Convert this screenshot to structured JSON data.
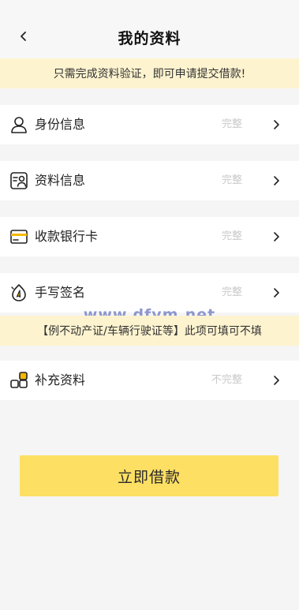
{
  "header": {
    "title": "我的资料",
    "back_icon": "chevron-left-icon"
  },
  "notice_top": "只需完成资料验证，即可申请提交借款!",
  "items": [
    {
      "label": "身份信息",
      "status": "完整",
      "icon": "person-icon"
    },
    {
      "label": "资料信息",
      "status": "完整",
      "icon": "id-card-icon"
    },
    {
      "label": "收款银行卡",
      "status": "完整",
      "icon": "bank-card-icon"
    },
    {
      "label": "手写签名",
      "status": "完整",
      "icon": "signature-pen-icon"
    }
  ],
  "notice_optional": "【例不动产证/车辆行驶证等】此项可填可不填",
  "supplement": {
    "label": "补充资料",
    "status": "不完整",
    "icon": "grid-blocks-icon"
  },
  "watermark": "www.dfym.net",
  "submit_label": "立即借款",
  "colors": {
    "accent": "#fddf63",
    "notice_bg": "#fdf3cf",
    "status_text": "#c9c9c9",
    "page_bg": "#f5f5f5"
  }
}
